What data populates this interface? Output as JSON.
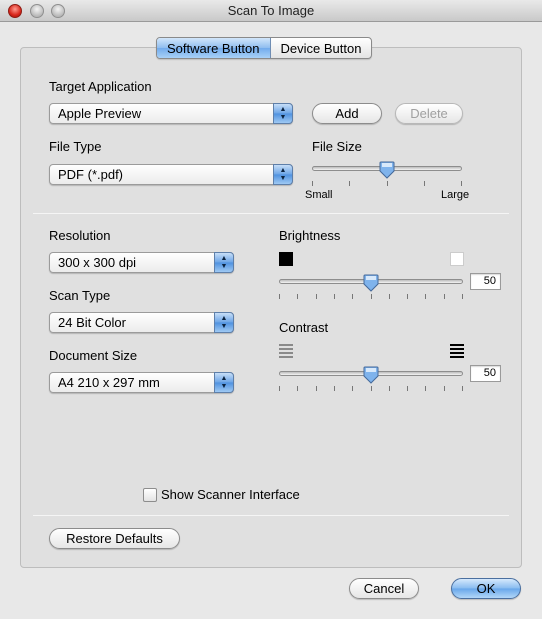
{
  "window": {
    "title": "Scan To Image"
  },
  "tabs": [
    {
      "label": "Software Button",
      "selected": true
    },
    {
      "label": "Device Button",
      "selected": false
    }
  ],
  "target_application": {
    "label": "Target Application",
    "value": "Apple Preview",
    "add_label": "Add",
    "delete_label": "Delete"
  },
  "file_type": {
    "label": "File Type",
    "value": "PDF (*.pdf)"
  },
  "file_size": {
    "label": "File Size",
    "min_label": "Small",
    "max_label": "Large",
    "level": 0.5
  },
  "resolution": {
    "label": "Resolution",
    "value": "300 x 300 dpi"
  },
  "scan_type": {
    "label": "Scan Type",
    "value": "24 Bit Color"
  },
  "document_size": {
    "label": "Document Size",
    "value": "A4  210 x 297 mm"
  },
  "brightness": {
    "label": "Brightness",
    "value": "50",
    "level": 0.5
  },
  "contrast": {
    "label": "Contrast",
    "value": "50",
    "level": 0.5
  },
  "show_scanner_interface": {
    "label": "Show Scanner Interface",
    "checked": false
  },
  "buttons": {
    "restore_defaults": "Restore Defaults",
    "cancel": "Cancel",
    "ok": "OK"
  },
  "colors": {
    "accent": "#6fa9ea",
    "window_bg": "#e8e8e8"
  }
}
